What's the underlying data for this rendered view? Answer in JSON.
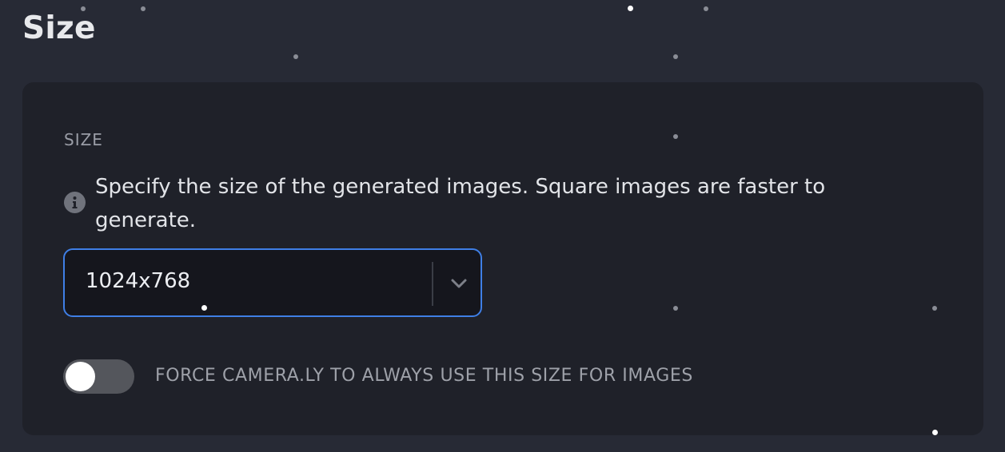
{
  "page": {
    "title": "Size"
  },
  "size_card": {
    "section_label": "SIZE",
    "info_icon": "info-icon",
    "description": "Specify the size of the generated images. Square images are faster to generate.",
    "select": {
      "value": "1024x768",
      "icon": "chevron-down-icon"
    },
    "force_toggle": {
      "label": "FORCE CAMERA.LY TO ALWAYS USE THIS SIZE FOR IMAGES",
      "on": false
    }
  },
  "colors": {
    "background": "#272a35",
    "card": "#1f2129",
    "accent_border": "#3f7fe6",
    "toggle_off": "#54565c"
  }
}
